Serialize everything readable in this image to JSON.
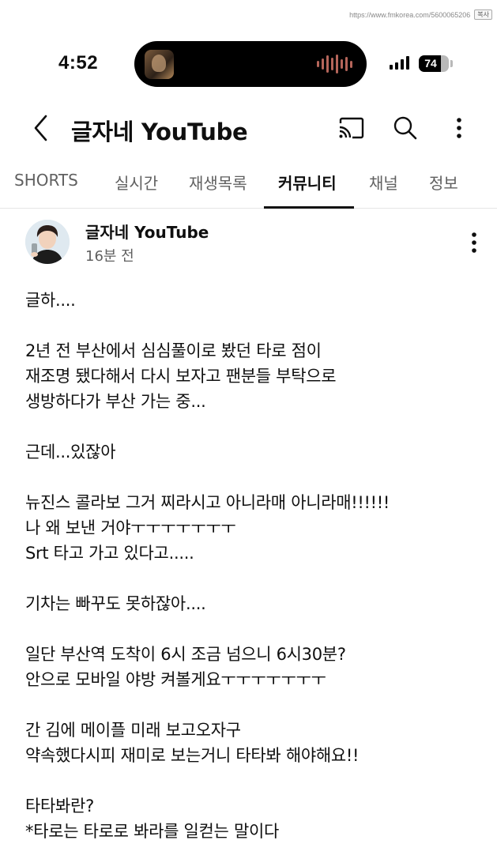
{
  "url_bar": {
    "url": "https://www.fmkorea.com/5600065206",
    "copy_label": "복사"
  },
  "status_bar": {
    "time": "4:52",
    "battery_percent": "74",
    "battery_level": 0.74,
    "signal_bars": 4
  },
  "header": {
    "channel_title": "글자네 YouTube",
    "icons": [
      "back-icon",
      "cast-icon",
      "search-icon",
      "more-vert-icon"
    ]
  },
  "tabs": [
    {
      "label": "SHORTS",
      "active": false
    },
    {
      "label": "실시간",
      "active": false
    },
    {
      "label": "재생목록",
      "active": false
    },
    {
      "label": "커뮤니티",
      "active": true
    },
    {
      "label": "채널",
      "active": false
    },
    {
      "label": "정보",
      "active": false
    }
  ],
  "post": {
    "author": "글자네 YouTube",
    "time": "16분 전",
    "lines": [
      "글하....",
      "",
      "2년 전 부산에서 심심풀이로 봤던 타로 점이",
      "재조명 됐다해서 다시 보자고 팬분들 부탁으로",
      "생방하다가 부산 가는 중...",
      "",
      "근데...있잖아",
      "",
      "뉴진스 콜라보 그거 찌라시고 아니라매 아니라매!!!!!!",
      "나 왜 보낸 거야ㅜㅜㅜㅜㅜㅜㅜ",
      "Srt 타고 가고 있다고.....",
      "",
      "기차는 빠꾸도 못하잖아....",
      "",
      "일단 부산역 도착이 6시 조금 넘으니 6시30분?",
      "안으로 모바일 야방 켜볼게요ㅜㅜㅜㅜㅜㅜㅜ",
      "",
      "간 김에 메이플 미래 보고오자구",
      "약속했다시피 재미로 보는거니 타타봐 해야해요!!",
      "",
      "타타봐란?",
      "*타로는 타로로 봐라를 일컫는 말이다"
    ]
  },
  "colors": {
    "text_primary": "#0f0f0f",
    "text_secondary": "#606060",
    "divider": "#e5e5e5",
    "island_wave": "#b5655a"
  }
}
